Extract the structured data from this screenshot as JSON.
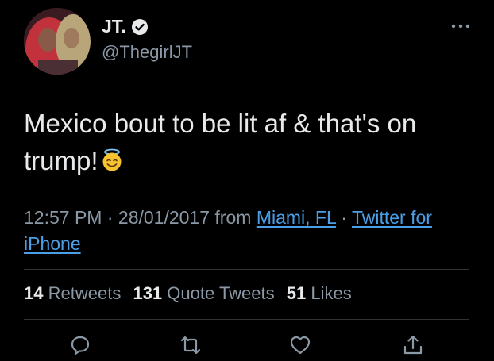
{
  "user": {
    "display_name": "JT.",
    "handle": "@ThegirlJT",
    "verified": true
  },
  "tweet": {
    "text": "Mexico bout to be lit af & that's on trump!",
    "emoji": "smiling-face-with-halo"
  },
  "meta": {
    "time": "12:57 PM",
    "sep1": " · ",
    "date": "28/01/2017",
    "from_label": " from ",
    "location": "Miami, FL",
    "sep2": " · ",
    "source": "Twitter for iPhone"
  },
  "stats": {
    "retweets_count": "14",
    "retweets_label": "Retweets",
    "quotes_count": "131",
    "quotes_label": "Quote Tweets",
    "likes_count": "51",
    "likes_label": "Likes"
  },
  "actions": [
    "reply",
    "retweet",
    "like",
    "share"
  ],
  "colors": {
    "background": "#000000",
    "text": "#e7e9ea",
    "muted": "#8b98a5",
    "link": "#4a9fe6",
    "divider": "#2f3336"
  }
}
